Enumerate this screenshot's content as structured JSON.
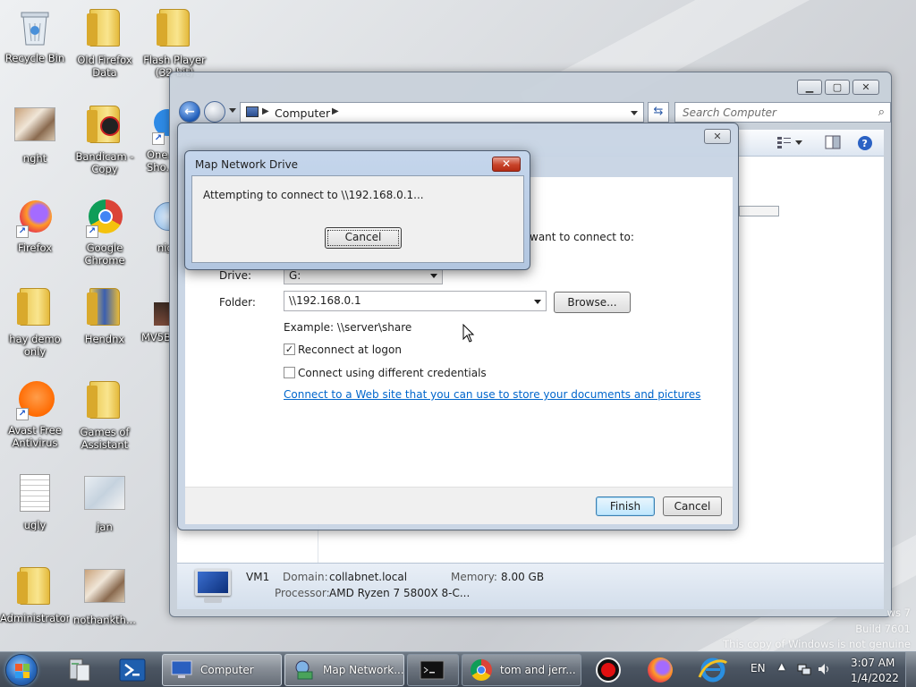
{
  "desktop": {
    "icons": [
      {
        "label": "Recycle Bin",
        "icon": "recycle-bin-icon"
      },
      {
        "label": "Old Firefox Data",
        "icon": "folder-icon"
      },
      {
        "label": "Flash Player (32-bit)",
        "icon": "folder-icon"
      },
      {
        "label": "nght",
        "icon": "image-thumbnail-icon"
      },
      {
        "label": "Bandicam - Copy",
        "icon": "folder-icon"
      },
      {
        "label": "One... Sho...",
        "icon": "onedrive-shortcut-icon"
      },
      {
        "label": "Firefox",
        "icon": "firefox-icon"
      },
      {
        "label": "Google Chrome",
        "icon": "chrome-icon"
      },
      {
        "label": "nig...",
        "icon": "shortcut-icon"
      },
      {
        "label": "hay demo only",
        "icon": "folder-icon"
      },
      {
        "label": "Hendnx",
        "icon": "folder-icon"
      },
      {
        "label": "MV5B...",
        "icon": "image-thumbnail-icon"
      },
      {
        "label": "Avast Free Antivirus",
        "icon": "avast-icon"
      },
      {
        "label": "Games of Assistant",
        "icon": "folder-icon"
      },
      {
        "label": "ugly",
        "icon": "document-icon"
      },
      {
        "label": "jan",
        "icon": "image-thumbnail-icon"
      },
      {
        "label": "Administrator",
        "icon": "folder-icon"
      },
      {
        "label": "nothankth...",
        "icon": "image-thumbnail-icon"
      }
    ]
  },
  "explorer": {
    "address": "Computer",
    "search_placeholder": "Search Computer",
    "details": {
      "name": "VM1",
      "domain_label": "Domain:",
      "domain_value": "collabnet.local",
      "memory_label": "Memory:",
      "memory_value": "8.00 GB",
      "processor_label": "Processor:",
      "processor_value": "AMD Ryzen 7 5800X 8-C..."
    }
  },
  "wizard": {
    "partial_prompt": "want to connect to:",
    "drive_label": "Drive:",
    "drive_value": "G:",
    "folder_label": "Folder:",
    "folder_value": "\\\\192.168.0.1",
    "browse_label": "Browse...",
    "example": "Example: \\\\server\\share",
    "reconnect_label": "Reconnect at logon",
    "reconnect_checked": true,
    "credentials_label": "Connect using different credentials",
    "credentials_checked": false,
    "web_link": "Connect to a Web site that you can use to store your documents and pictures",
    "web_link_suffix": ".",
    "finish_label": "Finish",
    "cancel_label": "Cancel"
  },
  "progress_dialog": {
    "title": "Map Network Drive",
    "message": "Attempting to connect to \\\\192.168.0.1...",
    "cancel_label": "Cancel"
  },
  "watermark": {
    "line1": "ws 7",
    "line2": "Build 7601",
    "line3": "This copy of Windows is not genuine"
  },
  "taskbar": {
    "tasks": [
      {
        "label": "Computer",
        "icon": "computer-icon"
      },
      {
        "label": "Map Network...",
        "icon": "network-drive-icon"
      },
      {
        "label": "",
        "icon": "cmd-icon"
      },
      {
        "label": "tom and jerr...",
        "icon": "chrome-icon"
      }
    ],
    "language": "EN",
    "time": "3:07 AM",
    "date": "1/4/2022"
  }
}
